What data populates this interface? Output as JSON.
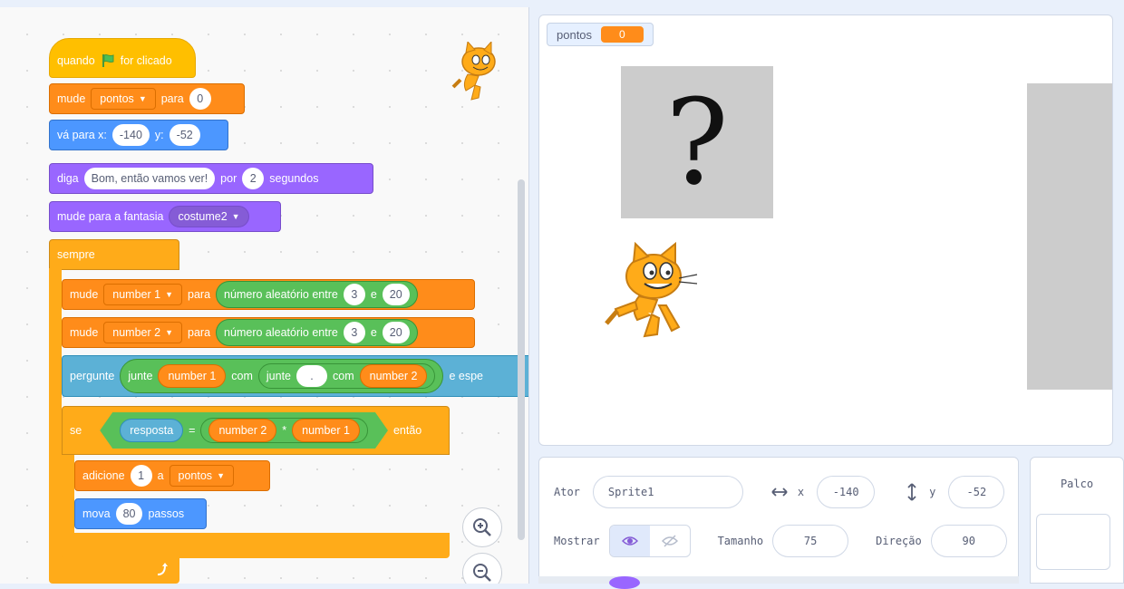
{
  "code": {
    "hat": {
      "when": "quando",
      "clicked": "for clicado"
    },
    "set_points": {
      "set": "mude",
      "var": "pontos",
      "to": "para",
      "value": "0"
    },
    "goto": {
      "label_x": "vá para x:",
      "x": "-140",
      "label_y": "y:",
      "y": "-52"
    },
    "say": {
      "say": "diga",
      "text": "Bom, então vamos ver!",
      "for": "por",
      "secs": "2",
      "unit": "segundos"
    },
    "costume": {
      "label": "mude para a fantasia",
      "value": "costume2"
    },
    "forever": "sempre",
    "set_n1": {
      "set": "mude",
      "var": "number 1",
      "to": "para",
      "op": "número aleatório entre",
      "a": "3",
      "and": "e",
      "b": "20"
    },
    "set_n2": {
      "set": "mude",
      "var": "number 2",
      "to": "para",
      "op": "número aleatório entre",
      "a": "3",
      "and": "e",
      "b": "20"
    },
    "ask": {
      "ask": "pergunte",
      "join1": "junte",
      "rep1": "number 1",
      "with1": "com",
      "join2": "junte",
      "blank": ".",
      "with2": "com",
      "rep2": "number 2",
      "wait": "e espe"
    },
    "if": {
      "if": "se",
      "answer": "resposta",
      "eq": "=",
      "rep_a": "number 2",
      "times": "*",
      "rep_b": "number 1",
      "then": "então"
    },
    "change": {
      "add": "adicione",
      "value": "1",
      "to": "a",
      "var": "pontos"
    },
    "move": {
      "move": "mova",
      "value": "80",
      "unit": "passos"
    }
  },
  "stage": {
    "monitor_label": "pontos",
    "monitor_value": "0",
    "question_mark": "?"
  },
  "sprite_info": {
    "ator_label": "Ator",
    "sprite_name": "Sprite1",
    "x_label": "x",
    "x_value": "-140",
    "y_label": "y",
    "y_value": "-52",
    "show_label": "Mostrar",
    "size_label": "Tamanho",
    "size_value": "75",
    "direction_label": "Direção",
    "direction_value": "90"
  },
  "palco": {
    "title": "Palco"
  },
  "icons": {
    "flag": "green-flag-icon",
    "zoom_in": "zoom-in-icon",
    "zoom_out": "zoom-out-icon",
    "eye": "eye-icon",
    "eye_off": "eye-off-icon",
    "loop_arrow": "loop-arrow-icon"
  },
  "colors": {
    "events": "#ffbf00",
    "variables": "#ff8c1a",
    "motion": "#4c97ff",
    "looks": "#9966ff",
    "control": "#ffab19",
    "operators": "#59c059",
    "sensing": "#5cb1d6"
  }
}
